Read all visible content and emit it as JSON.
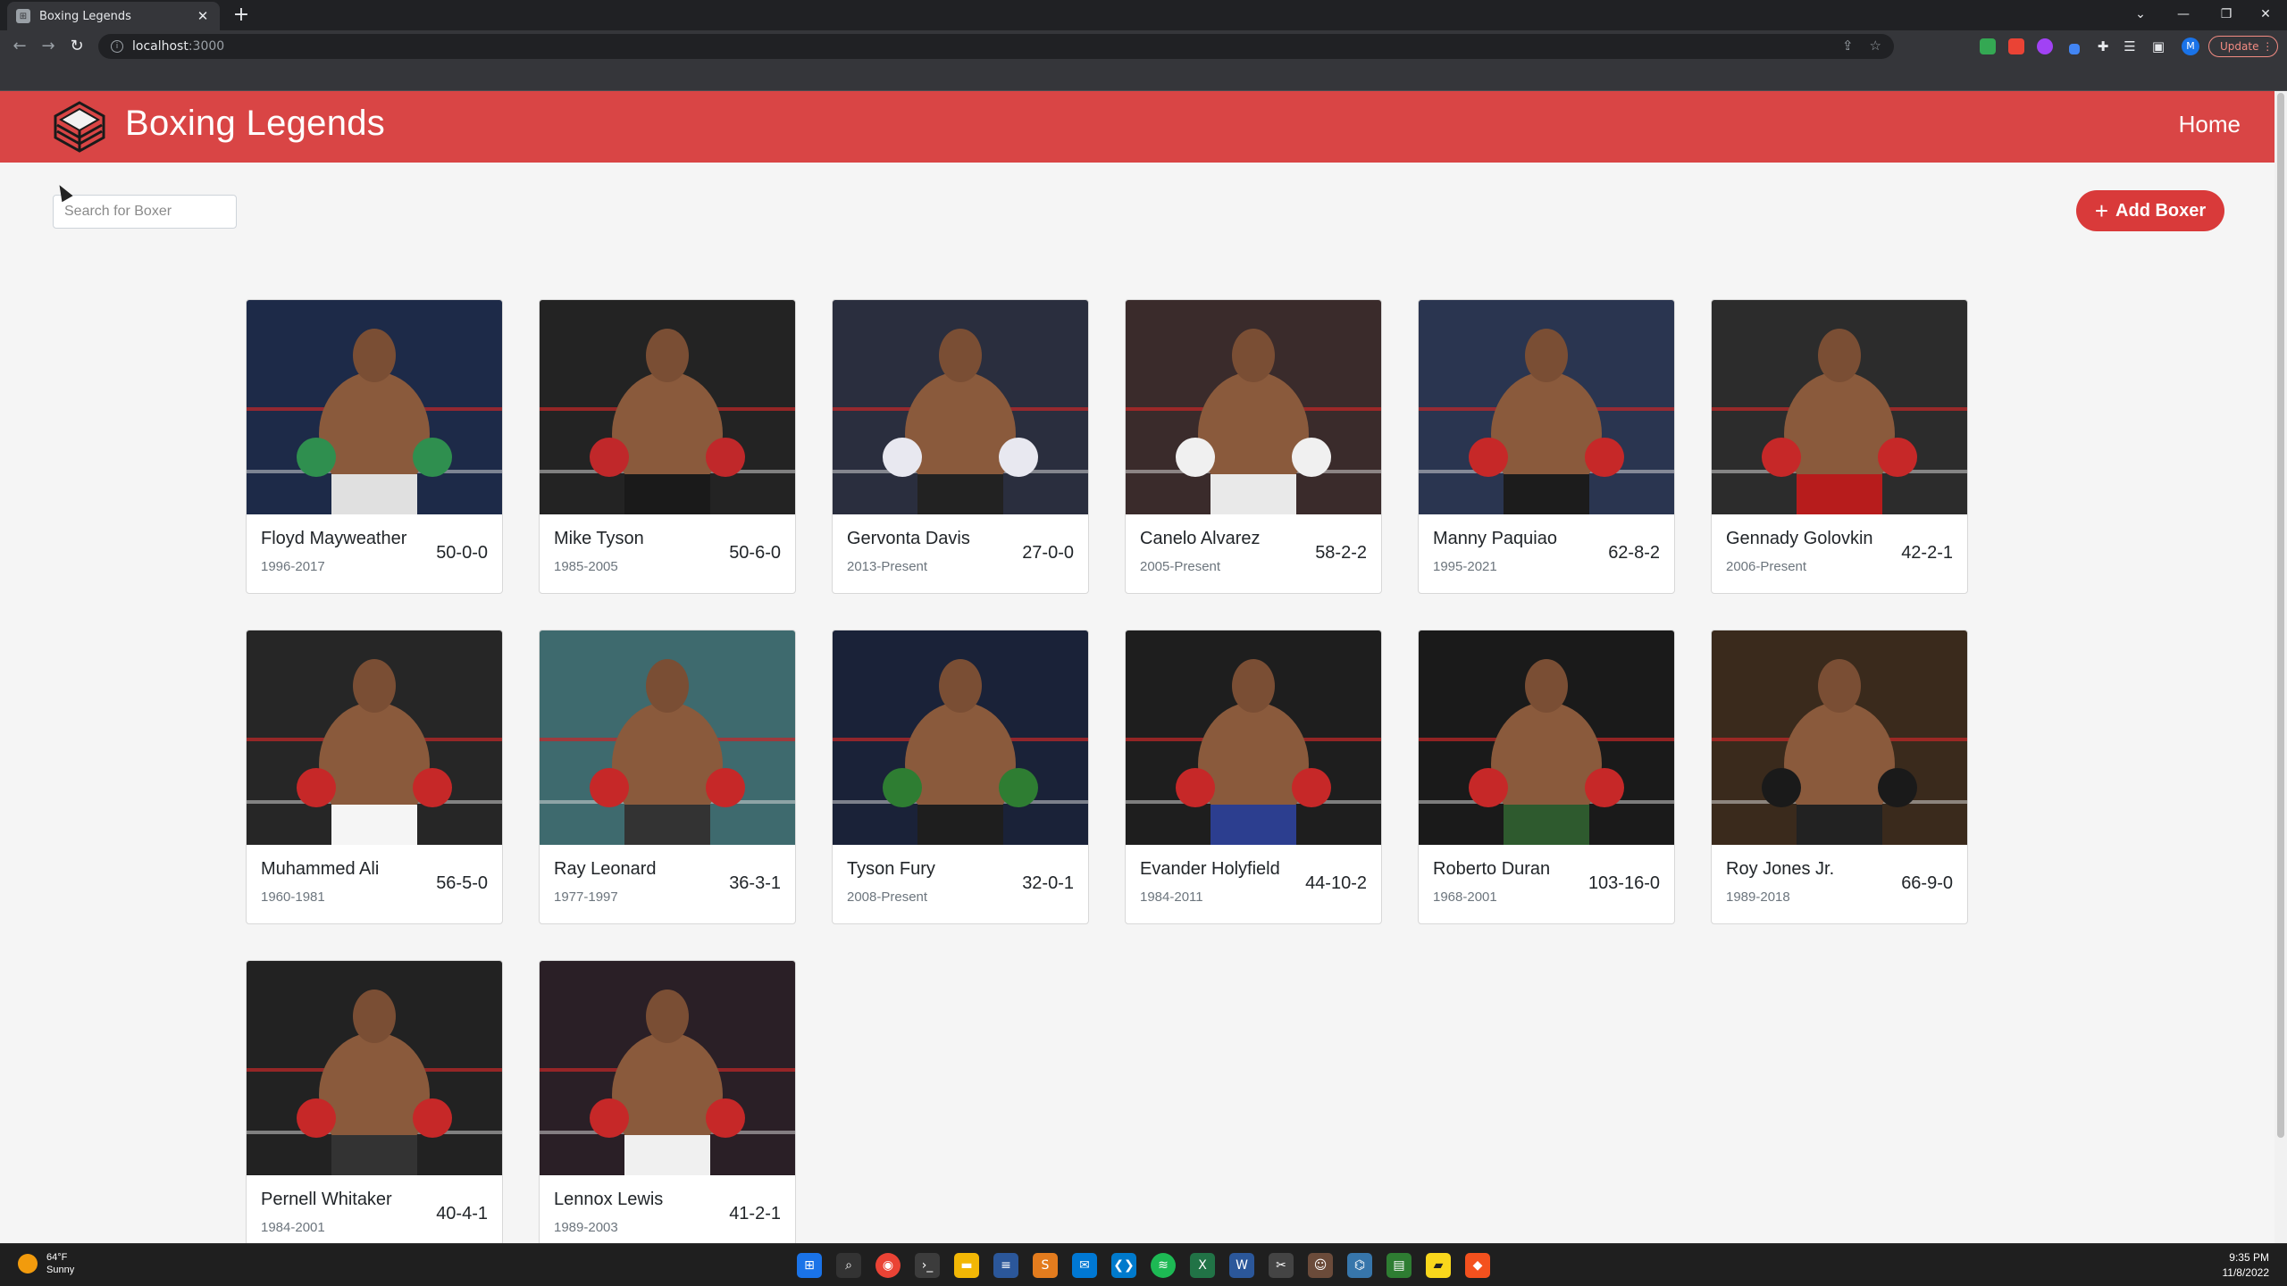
{
  "browser": {
    "tab_title": "Boxing Legends",
    "url_host": "localhost",
    "url_port": ":3000",
    "update_label": "Update",
    "profile_initial": "M"
  },
  "app": {
    "brand": "Boxing Legends",
    "nav_home": "Home",
    "search_placeholder": "Search for Boxer",
    "add_button": "Add Boxer",
    "accent_color": "#d94545"
  },
  "boxers": [
    {
      "name": "Floyd Mayweather",
      "years": "1996-2017",
      "record": "50-0-0",
      "bg": "#1d2a48",
      "trunks": "#e0e0e0",
      "gloves": "#2f8f4f"
    },
    {
      "name": "Mike Tyson",
      "years": "1985-2005",
      "record": "50-6-0",
      "bg": "#232323",
      "trunks": "#1a1a1a",
      "gloves": "#c0282a"
    },
    {
      "name": "Gervonta Davis",
      "years": "2013-Present",
      "record": "27-0-0",
      "bg": "#2a2e3e",
      "trunks": "#222",
      "gloves": "#e8e8f0"
    },
    {
      "name": "Canelo Alvarez",
      "years": "2005-Present",
      "record": "58-2-2",
      "bg": "#3a2b2b",
      "trunks": "#e9e9e9",
      "gloves": "#f0f0f0"
    },
    {
      "name": "Manny Paquiao",
      "years": "1995-2021",
      "record": "62-8-2",
      "bg": "#2a3550",
      "trunks": "#1c1c1c",
      "gloves": "#c62828"
    },
    {
      "name": "Gennady Golovkin",
      "years": "2006-Present",
      "record": "42-2-1",
      "bg": "#2c2c2c",
      "trunks": "#b71c1c",
      "gloves": "#c62828"
    },
    {
      "name": "Muhammed Ali",
      "years": "1960-1981",
      "record": "56-5-0",
      "bg": "#262626",
      "trunks": "#f5f5f5",
      "gloves": "#c62828"
    },
    {
      "name": "Ray Leonard",
      "years": "1977-1997",
      "record": "36-3-1",
      "bg": "#3e6a6e",
      "trunks": "#333",
      "gloves": "#c62828"
    },
    {
      "name": "Tyson Fury",
      "years": "2008-Present",
      "record": "32-0-1",
      "bg": "#1a2238",
      "trunks": "#1e1e1e",
      "gloves": "#2e7d32"
    },
    {
      "name": "Evander Holyfield",
      "years": "1984-2011",
      "record": "44-10-2",
      "bg": "#1e1e1e",
      "trunks": "#2c3e8f",
      "gloves": "#c62828"
    },
    {
      "name": "Roberto Duran",
      "years": "1968-2001",
      "record": "103-16-0",
      "bg": "#1a1a1a",
      "trunks": "#2e5a2e",
      "gloves": "#c62828"
    },
    {
      "name": "Roy Jones Jr.",
      "years": "1989-2018",
      "record": "66-9-0",
      "bg": "#3a2a1c",
      "trunks": "#222",
      "gloves": "#1a1a1a"
    },
    {
      "name": "Pernell Whitaker",
      "years": "1984-2001",
      "record": "40-4-1",
      "bg": "#222",
      "trunks": "#333",
      "gloves": "#c62828"
    },
    {
      "name": "Lennox Lewis",
      "years": "1989-2003",
      "record": "41-2-1",
      "bg": "#2a1f26",
      "trunks": "#f0f0f0",
      "gloves": "#c62828"
    }
  ],
  "taskbar": {
    "temp": "64°F",
    "condition": "Sunny",
    "time": "9:35 PM",
    "date": "11/8/2022"
  }
}
